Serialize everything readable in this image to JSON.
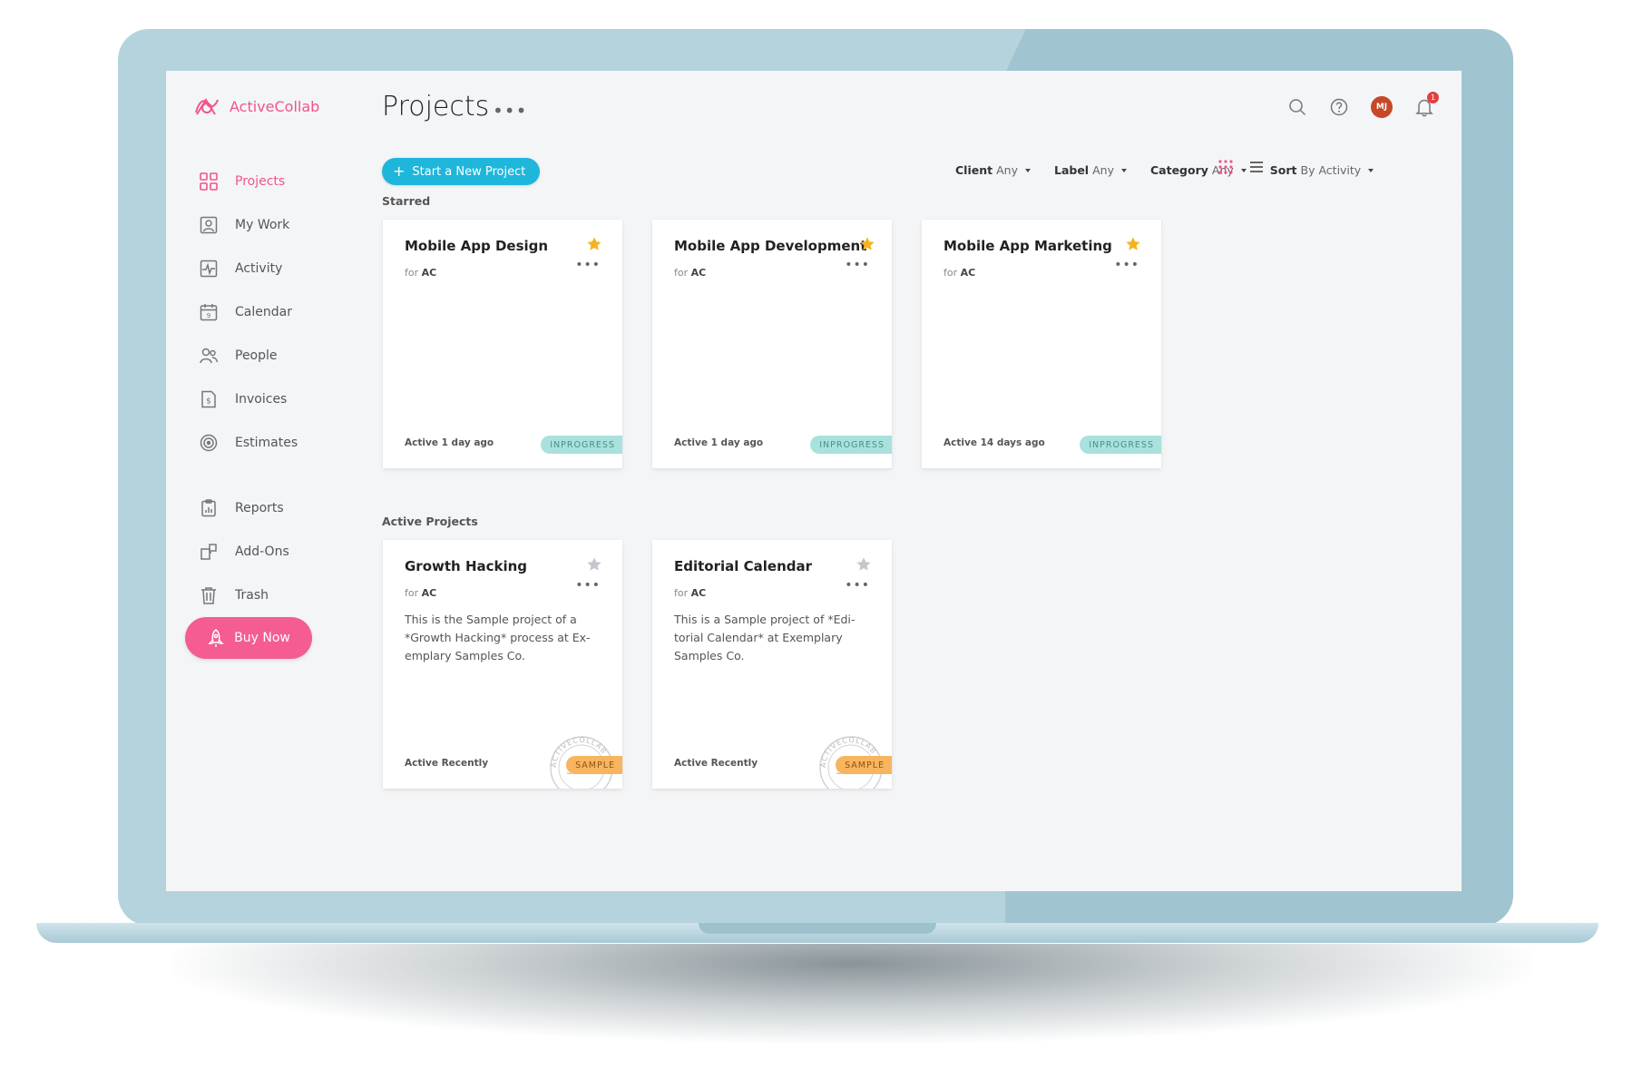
{
  "app": {
    "name": "ActiveCollab",
    "brand_color": "#f2548b"
  },
  "sidebar": {
    "items": [
      {
        "label": "Projects",
        "icon": "projects-grid-icon",
        "active": true
      },
      {
        "label": "My Work",
        "icon": "my-work-icon"
      },
      {
        "label": "Activity",
        "icon": "activity-icon"
      },
      {
        "label": "Calendar",
        "icon": "calendar-icon"
      },
      {
        "label": "People",
        "icon": "people-icon"
      },
      {
        "label": "Invoices",
        "icon": "invoice-icon"
      },
      {
        "label": "Estimates",
        "icon": "estimates-icon"
      },
      {
        "label": "Reports",
        "icon": "reports-icon"
      },
      {
        "label": "Add-Ons",
        "icon": "add-ons-icon"
      },
      {
        "label": "Trash",
        "icon": "trash-icon"
      }
    ],
    "buy_label": "Buy Now"
  },
  "header": {
    "title": "Projects",
    "more": "•••",
    "avatar_initials": "MJ",
    "notification_count": "1"
  },
  "toolbar": {
    "new_project_label": "Start a New Project",
    "filters": [
      {
        "label": "Client",
        "value": "Any"
      },
      {
        "label": "Label",
        "value": "Any"
      },
      {
        "label": "Category",
        "value": "Any"
      },
      {
        "label": "Sort",
        "value": "By Activity"
      }
    ]
  },
  "sections": {
    "starred": "Starred",
    "active": "Active Projects"
  },
  "starred_projects": [
    {
      "title": "Mobile App Design",
      "client_prefix": "for",
      "client": "AC",
      "activity": "Active 1 day ago",
      "status": "INPROGRESS"
    },
    {
      "title": "Mobile App Development",
      "client_prefix": "for",
      "client": "AC",
      "activity": "Active 1 day ago",
      "status": "INPROGRESS"
    },
    {
      "title": "Mobile App Marketing",
      "client_prefix": "for",
      "client": "AC",
      "activity": "Active 14 days ago",
      "status": "INPROGRESS"
    }
  ],
  "active_projects": [
    {
      "title": "Growth Hacking",
      "client_prefix": "for",
      "client": "AC",
      "description": "This is the Sample project of a *Growth Hacking* process at Ex-emplary Samples Co.",
      "activity": "Active Recently",
      "status": "SAMPLE"
    },
    {
      "title": "Editorial Calendar",
      "client_prefix": "for",
      "client": "AC",
      "description": "This is a Sample project of *Edi-torial Calendar* at Exemplary Samples Co.",
      "activity": "Active Recently",
      "status": "SAMPLE"
    }
  ],
  "stamp_text": "ACTIVECOLLAB S",
  "stamp_center": "SA",
  "colors": {
    "accent_blue": "#1fb6dc",
    "star_gold": "#f5b323",
    "star_gray": "#c4c7cc",
    "inprogress_bg": "#a9e1dc",
    "sample_bg": "#f8b45e"
  }
}
